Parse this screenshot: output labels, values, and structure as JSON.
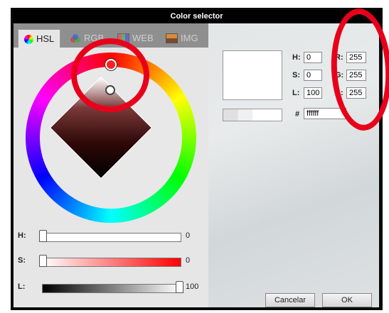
{
  "window": {
    "title": "Color selector"
  },
  "tabs": [
    {
      "label": "HSL",
      "icon": "color-wheel-icon",
      "active": true
    },
    {
      "label": "RGB",
      "icon": "rgb-icon",
      "active": false
    },
    {
      "label": "WEB",
      "icon": "grid-icon",
      "active": false
    },
    {
      "label": "IMG",
      "icon": "image-icon",
      "active": false
    }
  ],
  "sliders": {
    "h": {
      "label": "H:",
      "value": "0",
      "level": 0,
      "colors": [
        "#ffffff",
        "#ffffff"
      ]
    },
    "s": {
      "label": "S:",
      "value": "0",
      "level": 0,
      "colors": [
        "#ffffff",
        "#ff0000"
      ]
    },
    "l": {
      "label": "L:",
      "value": "100",
      "level": 1.0,
      "colors": [
        "#000000",
        "#ffffff"
      ]
    }
  },
  "hsl_fields": {
    "h": {
      "label": "H:",
      "value": "0"
    },
    "s": {
      "label": "S:",
      "value": "0"
    },
    "l": {
      "label": "L:",
      "value": "100"
    }
  },
  "rgb_fields": {
    "r": {
      "label": "R:",
      "value": "255"
    },
    "g": {
      "label": "G:",
      "value": "255"
    },
    "b": {
      "label": "B:",
      "value": "255"
    }
  },
  "hex": {
    "label": "#",
    "value": "ffffff"
  },
  "preview_color": "#ffffff",
  "buttons": {
    "cancel": "Cancelar",
    "ok": "OK"
  },
  "annotation_color": "#e8001a"
}
